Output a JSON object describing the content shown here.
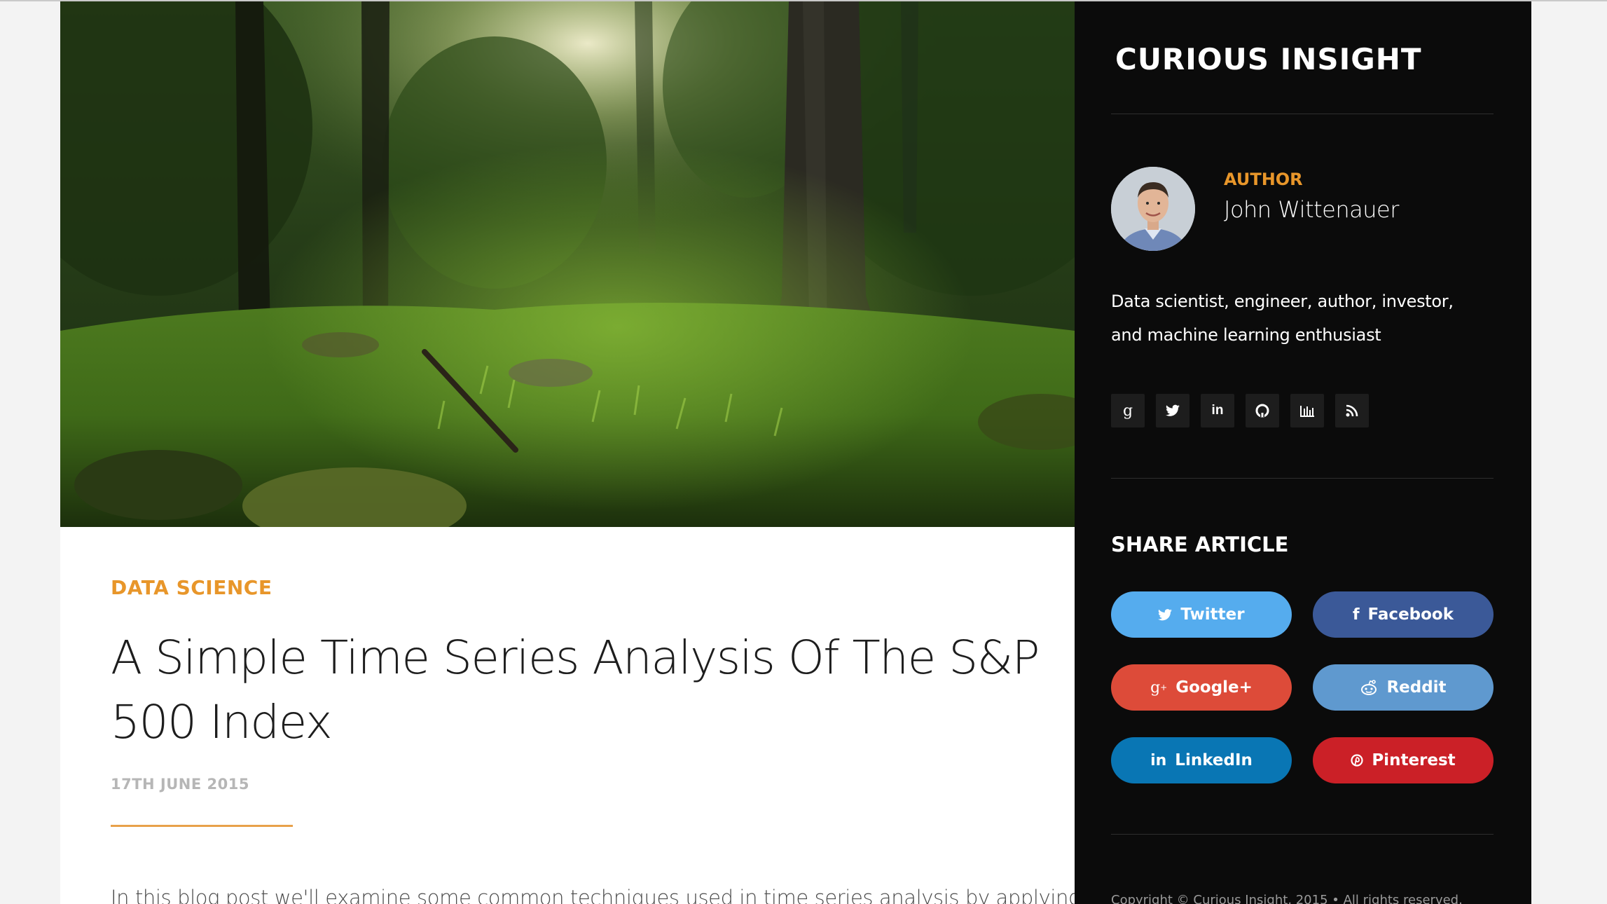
{
  "brand": "CURIOUS INSIGHT",
  "article": {
    "category": "DATA SCIENCE",
    "title": "A Simple Time Series Analysis Of The S&P 500 Index",
    "date": "17TH JUNE 2015",
    "intro": "In this blog post we'll examine some common techniques used in time series analysis by applying them to a"
  },
  "author": {
    "label": "AUTHOR",
    "name": "John Wittenauer",
    "bio": "Data scientist, engineer, author, investor, and machine learning enthusiast"
  },
  "social_links": [
    {
      "name": "google-plus-icon",
      "glyph": "g"
    },
    {
      "name": "twitter-icon",
      "glyph": "t"
    },
    {
      "name": "linkedin-icon",
      "glyph": "in"
    },
    {
      "name": "github-icon",
      "glyph": "gh"
    },
    {
      "name": "stats-icon",
      "glyph": "bars"
    },
    {
      "name": "rss-icon",
      "glyph": "rss"
    }
  ],
  "share": {
    "title": "SHARE ARTICLE",
    "buttons": [
      {
        "label": "Twitter",
        "color": "#55acee",
        "icon": "twitter-icon"
      },
      {
        "label": "Facebook",
        "color": "#3b5998",
        "icon": "facebook-icon"
      },
      {
        "label": "Google+",
        "color": "#dd4b39",
        "icon": "google-plus-icon"
      },
      {
        "label": "Reddit",
        "color": "#5f99cf",
        "icon": "reddit-icon"
      },
      {
        "label": "LinkedIn",
        "color": "#0976b4",
        "icon": "linkedin-icon"
      },
      {
        "label": "Pinterest",
        "color": "#cb2027",
        "icon": "pinterest-icon"
      }
    ]
  },
  "footer": {
    "copyright": "Copyright © Curious Insight, 2015 • All rights reserved."
  },
  "colors": {
    "accent": "#e8962a",
    "sidebar_bg": "#0b0b0b"
  }
}
